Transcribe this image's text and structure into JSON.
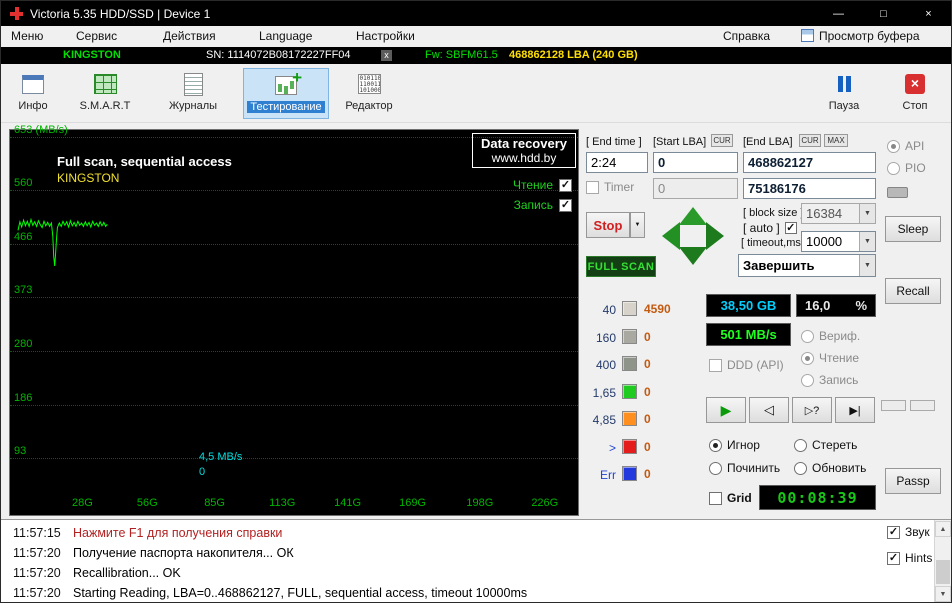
{
  "window": {
    "title": "Victoria 5.35 HDD/SSD | Device 1",
    "controls": {
      "minimize": "—",
      "maximize": "□",
      "close": "×"
    }
  },
  "menubar": {
    "items": [
      "Меню",
      "Сервис",
      "Действия",
      "Language",
      "Настройки"
    ],
    "help": "Справка",
    "buffer_view": "Просмотр буфера"
  },
  "device_bar": {
    "model": "KINGSTON",
    "serial": "SN: 1114072B08172227FF04",
    "close": "x",
    "firmware": "Fw: SBFM61.5",
    "capacity": "468862128 LBA (240 GB)"
  },
  "toolbar": {
    "buttons": [
      {
        "label": "Инфо"
      },
      {
        "label": "S.M.A.R.T"
      },
      {
        "label": "Журналы"
      },
      {
        "label": "Тестирование"
      },
      {
        "label": "Редактор"
      }
    ],
    "pause": "Пауза",
    "stop": "Стоп"
  },
  "graph": {
    "title": "Full scan, sequential access",
    "subtitle": "KINGSTON",
    "badge_line1": "Data recovery",
    "badge_line2": "www.hdd.by",
    "read_label": "Чтение",
    "write_label": "Запись",
    "cursor_speed": "4,5 MB/s",
    "cursor_value": "0",
    "y_axis": [
      {
        "value": 653,
        "label": "653 (MB/s)"
      },
      {
        "value": 560,
        "label": "560"
      },
      {
        "value": 466,
        "label": "466"
      },
      {
        "value": 373,
        "label": "373"
      },
      {
        "value": 280,
        "label": "280"
      },
      {
        "value": 186,
        "label": "186"
      },
      {
        "value": 93,
        "label": "93"
      }
    ],
    "x_axis": [
      {
        "gb": 28,
        "label": "28G"
      },
      {
        "gb": 56,
        "label": "56G"
      },
      {
        "gb": 85,
        "label": "85G"
      },
      {
        "gb": 113,
        "label": "113G"
      },
      {
        "gb": 141,
        "label": "141G"
      },
      {
        "gb": 169,
        "label": "169G"
      },
      {
        "gb": 198,
        "label": "198G"
      },
      {
        "gb": 226,
        "label": "226G"
      }
    ],
    "series": [
      [
        0,
        490
      ],
      [
        0.8,
        505
      ],
      [
        1.6,
        496
      ],
      [
        2.4,
        508
      ],
      [
        3.2,
        498
      ],
      [
        4,
        506
      ],
      [
        4.8,
        497
      ],
      [
        5.6,
        509
      ],
      [
        6.4,
        499
      ],
      [
        7.2,
        505
      ],
      [
        8,
        497
      ],
      [
        8.8,
        507
      ],
      [
        9.6,
        500
      ],
      [
        10.4,
        495
      ],
      [
        11.2,
        506
      ],
      [
        12,
        498
      ],
      [
        12.8,
        504
      ],
      [
        13.6,
        497
      ],
      [
        14.4,
        503
      ],
      [
        15,
        480
      ],
      [
        15.4,
        445
      ],
      [
        15.8,
        428
      ],
      [
        16.2,
        450
      ],
      [
        16.6,
        475
      ],
      [
        17,
        495
      ],
      [
        17.8,
        503
      ],
      [
        18.6,
        497
      ],
      [
        19.4,
        506
      ],
      [
        20.2,
        499
      ],
      [
        21,
        505
      ],
      [
        21.8,
        496
      ],
      [
        22.6,
        507
      ],
      [
        23.4,
        498
      ],
      [
        24.2,
        504
      ],
      [
        25,
        497
      ],
      [
        25.8,
        506
      ],
      [
        26.6,
        499
      ],
      [
        27.4,
        503
      ],
      [
        28.2,
        497
      ],
      [
        29,
        505
      ],
      [
        29.8,
        498
      ],
      [
        30.6,
        504
      ],
      [
        31.4,
        496
      ],
      [
        32.2,
        506
      ],
      [
        33,
        499
      ],
      [
        33.8,
        503
      ],
      [
        34.6,
        497
      ],
      [
        35.4,
        505
      ],
      [
        36.2,
        498
      ],
      [
        37,
        504
      ],
      [
        37.8,
        497
      ],
      [
        38.5,
        501
      ]
    ]
  },
  "controls": {
    "end_time_label": "[ End time ]",
    "end_time": "2:24",
    "start_lba_label": "[Start LBA]",
    "cur1": "CUR",
    "start_lba": "0",
    "end_lba_label": "[End LBA]",
    "cur2": "CUR",
    "max": "MAX",
    "end_lba": "468862127",
    "timer_label": "Timer",
    "timer_value": "0",
    "current_lba": "75186176",
    "stop_label": "Stop",
    "block_size_label": "[ block size ]",
    "block_size": "16384",
    "auto_label": "[ auto ]",
    "timeout_label": "[ timeout,ms ]",
    "timeout": "10000",
    "scan_mode": "FULL SCAN",
    "action_select": "Завершить",
    "buckets": [
      {
        "label": "40",
        "color": "#d7d3cb",
        "label_color": "#233a6b",
        "count": "4590"
      },
      {
        "label": "160",
        "color": "#a9a9a1",
        "label_color": "#233a6b",
        "count": "0"
      },
      {
        "label": "400",
        "color": "#8e948a",
        "label_color": "#233a6b",
        "count": "0"
      },
      {
        "label": "1,65",
        "color": "#1ecb1e",
        "label_color": "#233a6b",
        "count": "0"
      },
      {
        "label": "4,85",
        "color": "#ff9020",
        "label_color": "#233a6b",
        "count": "0"
      },
      {
        "label": ">",
        "color": "#e51c1c",
        "label_color": "#2244cc",
        "count": "0"
      },
      {
        "label": "Err",
        "color": "#2239dd",
        "label_color": "#2244cc",
        "count": "0"
      }
    ],
    "progress_gb": "38,50 GB",
    "progress_pct_value": "16,0",
    "progress_pct_sign": "%",
    "speed": "501 MB/s",
    "verify_label": "Вериф.",
    "read_label": "Чтение",
    "write_label": "Запись",
    "ddd_label": "DDD (API)",
    "defect_actions": [
      {
        "label": "Игнор"
      },
      {
        "label": "Стереть"
      },
      {
        "label": "Починить"
      },
      {
        "label": "Обновить"
      }
    ],
    "grid_label": "Grid",
    "elapsed": "00:08:39",
    "colors": {
      "gb": "#00d0ff",
      "speed": "#20ff20",
      "segment": "#18c818"
    }
  },
  "side": {
    "api": "API",
    "pio": "PIO",
    "sleep": "Sleep",
    "recall": "Recall",
    "passp": "Passp",
    "sound": "Звук",
    "hints": "Hints"
  },
  "log": {
    "entries": [
      {
        "time": "11:57:15",
        "text": "Нажмите F1 для получения справки",
        "color": "#b22222"
      },
      {
        "time": "11:57:20",
        "text": "Получение паспорта накопителя... ОК",
        "color": "#000000"
      },
      {
        "time": "11:57:20",
        "text": "Recallibration... OK",
        "color": "#000000"
      },
      {
        "time": "11:57:20",
        "text": "Starting Reading, LBA=0..468862127, FULL, sequential access, timeout 10000ms",
        "color": "#000000"
      }
    ]
  }
}
